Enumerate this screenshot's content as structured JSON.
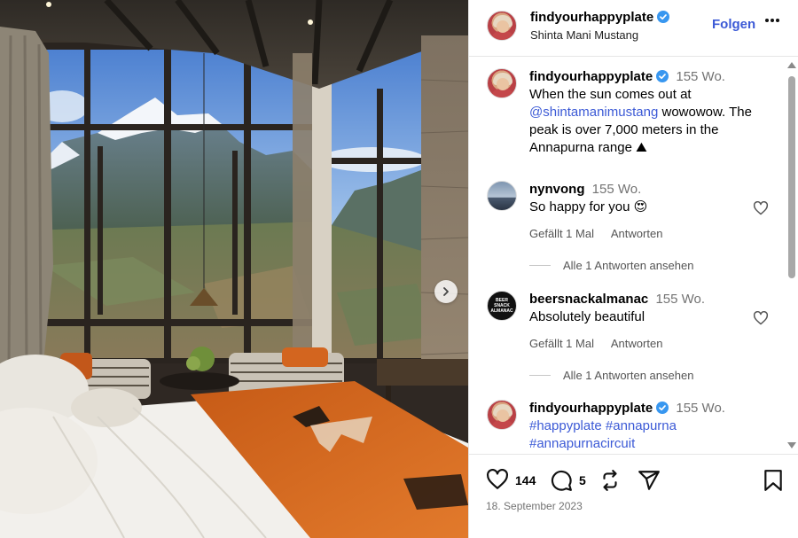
{
  "post": {
    "author": "findyourhappyplate",
    "location": "Shinta Mani Mustang",
    "follow_label": "Folgen",
    "caption_time": "155 Wo.",
    "caption_text_1": "When the sun comes out at",
    "caption_mention": "@shintamanimustang",
    "caption_text_2": "wowowow. The peak is over 7,000 meters in the Annapurna range",
    "caption_emoji": "⛰"
  },
  "comments": [
    {
      "user": "nynvong",
      "time": "155 Wo.",
      "text": "So happy for you 😍",
      "likes_label": "Gefällt 1 Mal",
      "reply_label": "Antworten",
      "view_replies": "Alle 1 Antworten ansehen"
    },
    {
      "user": "beersnackalmanac",
      "time": "155 Wo.",
      "text": "Absolutely beautiful",
      "likes_label": "Gefällt 1 Mal",
      "reply_label": "Antworten",
      "view_replies": "Alle 1 Antworten ansehen",
      "avatar_text": "BEER SNACK ALMANAC"
    },
    {
      "user": "findyourhappyplate",
      "time": "155 Wo.",
      "tags": "#happyplate #annapurna #annapurnacircuit"
    }
  ],
  "actions": {
    "like_count": "144",
    "comment_count": "5",
    "date": "18. September 2023"
  },
  "icons": {
    "verified": "verified-badge-icon",
    "more": "more-options-icon",
    "like": "heart-icon",
    "comment": "comment-icon",
    "repost": "repost-icon",
    "share": "share-icon",
    "save": "bookmark-icon",
    "next": "chevron-right-icon"
  },
  "colors": {
    "link": "#3c5ad6",
    "verified": "#3897f0",
    "blanket": "#d96a1f"
  }
}
